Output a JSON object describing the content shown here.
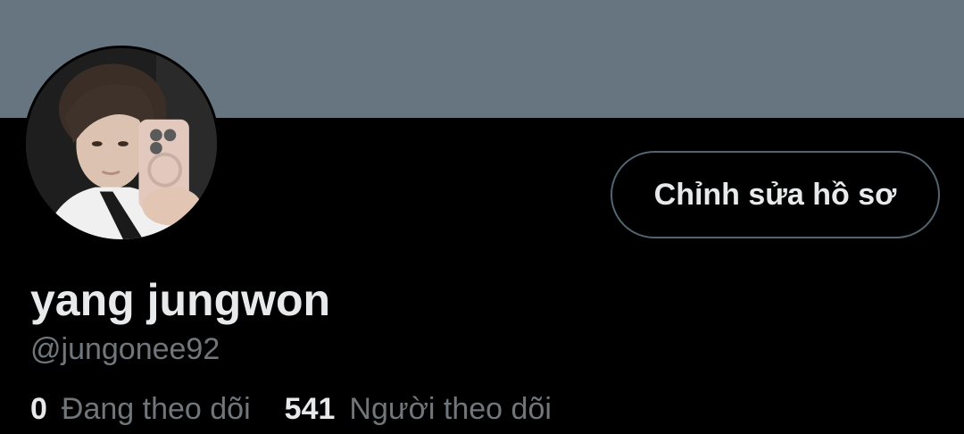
{
  "profile": {
    "display_name": "yang jungwon",
    "handle": "@jungonee92",
    "edit_button_label": "Chỉnh sửa hồ sơ",
    "avatar_icon": "profile-photo"
  },
  "stats": {
    "following": {
      "count": "0",
      "label": "Đang theo dõi"
    },
    "followers": {
      "count": "541",
      "label": "Người theo dõi"
    }
  },
  "colors": {
    "banner": "#66757f",
    "background": "#000000",
    "primary_text": "#e7e9ea",
    "secondary_text": "#71767b",
    "button_border": "#536471"
  }
}
